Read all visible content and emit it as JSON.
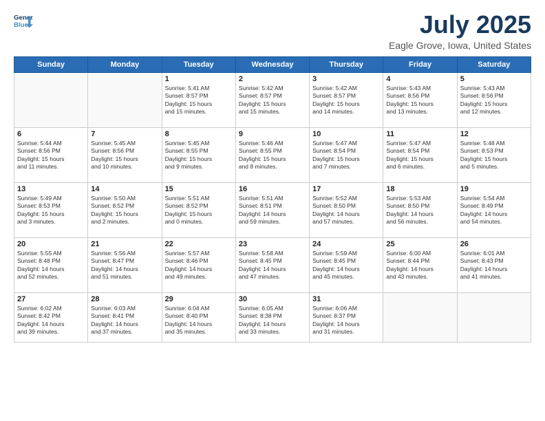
{
  "header": {
    "logo_line1": "General",
    "logo_line2": "Blue",
    "month": "July 2025",
    "location": "Eagle Grove, Iowa, United States"
  },
  "weekdays": [
    "Sunday",
    "Monday",
    "Tuesday",
    "Wednesday",
    "Thursday",
    "Friday",
    "Saturday"
  ],
  "weeks": [
    [
      {
        "day": "",
        "info": ""
      },
      {
        "day": "",
        "info": ""
      },
      {
        "day": "1",
        "info": "Sunrise: 5:41 AM\nSunset: 8:57 PM\nDaylight: 15 hours\nand 15 minutes."
      },
      {
        "day": "2",
        "info": "Sunrise: 5:42 AM\nSunset: 8:57 PM\nDaylight: 15 hours\nand 15 minutes."
      },
      {
        "day": "3",
        "info": "Sunrise: 5:42 AM\nSunset: 8:57 PM\nDaylight: 15 hours\nand 14 minutes."
      },
      {
        "day": "4",
        "info": "Sunrise: 5:43 AM\nSunset: 8:56 PM\nDaylight: 15 hours\nand 13 minutes."
      },
      {
        "day": "5",
        "info": "Sunrise: 5:43 AM\nSunset: 8:56 PM\nDaylight: 15 hours\nand 12 minutes."
      }
    ],
    [
      {
        "day": "6",
        "info": "Sunrise: 5:44 AM\nSunset: 8:56 PM\nDaylight: 15 hours\nand 11 minutes."
      },
      {
        "day": "7",
        "info": "Sunrise: 5:45 AM\nSunset: 8:56 PM\nDaylight: 15 hours\nand 10 minutes."
      },
      {
        "day": "8",
        "info": "Sunrise: 5:45 AM\nSunset: 8:55 PM\nDaylight: 15 hours\nand 9 minutes."
      },
      {
        "day": "9",
        "info": "Sunrise: 5:46 AM\nSunset: 8:55 PM\nDaylight: 15 hours\nand 8 minutes."
      },
      {
        "day": "10",
        "info": "Sunrise: 5:47 AM\nSunset: 8:54 PM\nDaylight: 15 hours\nand 7 minutes."
      },
      {
        "day": "11",
        "info": "Sunrise: 5:47 AM\nSunset: 8:54 PM\nDaylight: 15 hours\nand 6 minutes."
      },
      {
        "day": "12",
        "info": "Sunrise: 5:48 AM\nSunset: 8:53 PM\nDaylight: 15 hours\nand 5 minutes."
      }
    ],
    [
      {
        "day": "13",
        "info": "Sunrise: 5:49 AM\nSunset: 8:53 PM\nDaylight: 15 hours\nand 3 minutes."
      },
      {
        "day": "14",
        "info": "Sunrise: 5:50 AM\nSunset: 8:52 PM\nDaylight: 15 hours\nand 2 minutes."
      },
      {
        "day": "15",
        "info": "Sunrise: 5:51 AM\nSunset: 8:52 PM\nDaylight: 15 hours\nand 0 minutes."
      },
      {
        "day": "16",
        "info": "Sunrise: 5:51 AM\nSunset: 8:51 PM\nDaylight: 14 hours\nand 59 minutes."
      },
      {
        "day": "17",
        "info": "Sunrise: 5:52 AM\nSunset: 8:50 PM\nDaylight: 14 hours\nand 57 minutes."
      },
      {
        "day": "18",
        "info": "Sunrise: 5:53 AM\nSunset: 8:50 PM\nDaylight: 14 hours\nand 56 minutes."
      },
      {
        "day": "19",
        "info": "Sunrise: 5:54 AM\nSunset: 8:49 PM\nDaylight: 14 hours\nand 54 minutes."
      }
    ],
    [
      {
        "day": "20",
        "info": "Sunrise: 5:55 AM\nSunset: 8:48 PM\nDaylight: 14 hours\nand 52 minutes."
      },
      {
        "day": "21",
        "info": "Sunrise: 5:56 AM\nSunset: 8:47 PM\nDaylight: 14 hours\nand 51 minutes."
      },
      {
        "day": "22",
        "info": "Sunrise: 5:57 AM\nSunset: 8:46 PM\nDaylight: 14 hours\nand 49 minutes."
      },
      {
        "day": "23",
        "info": "Sunrise: 5:58 AM\nSunset: 8:45 PM\nDaylight: 14 hours\nand 47 minutes."
      },
      {
        "day": "24",
        "info": "Sunrise: 5:59 AM\nSunset: 8:45 PM\nDaylight: 14 hours\nand 45 minutes."
      },
      {
        "day": "25",
        "info": "Sunrise: 6:00 AM\nSunset: 8:44 PM\nDaylight: 14 hours\nand 43 minutes."
      },
      {
        "day": "26",
        "info": "Sunrise: 6:01 AM\nSunset: 8:43 PM\nDaylight: 14 hours\nand 41 minutes."
      }
    ],
    [
      {
        "day": "27",
        "info": "Sunrise: 6:02 AM\nSunset: 8:42 PM\nDaylight: 14 hours\nand 39 minutes."
      },
      {
        "day": "28",
        "info": "Sunrise: 6:03 AM\nSunset: 8:41 PM\nDaylight: 14 hours\nand 37 minutes."
      },
      {
        "day": "29",
        "info": "Sunrise: 6:04 AM\nSunset: 8:40 PM\nDaylight: 14 hours\nand 35 minutes."
      },
      {
        "day": "30",
        "info": "Sunrise: 6:05 AM\nSunset: 8:38 PM\nDaylight: 14 hours\nand 33 minutes."
      },
      {
        "day": "31",
        "info": "Sunrise: 6:06 AM\nSunset: 8:37 PM\nDaylight: 14 hours\nand 31 minutes."
      },
      {
        "day": "",
        "info": ""
      },
      {
        "day": "",
        "info": ""
      }
    ]
  ]
}
